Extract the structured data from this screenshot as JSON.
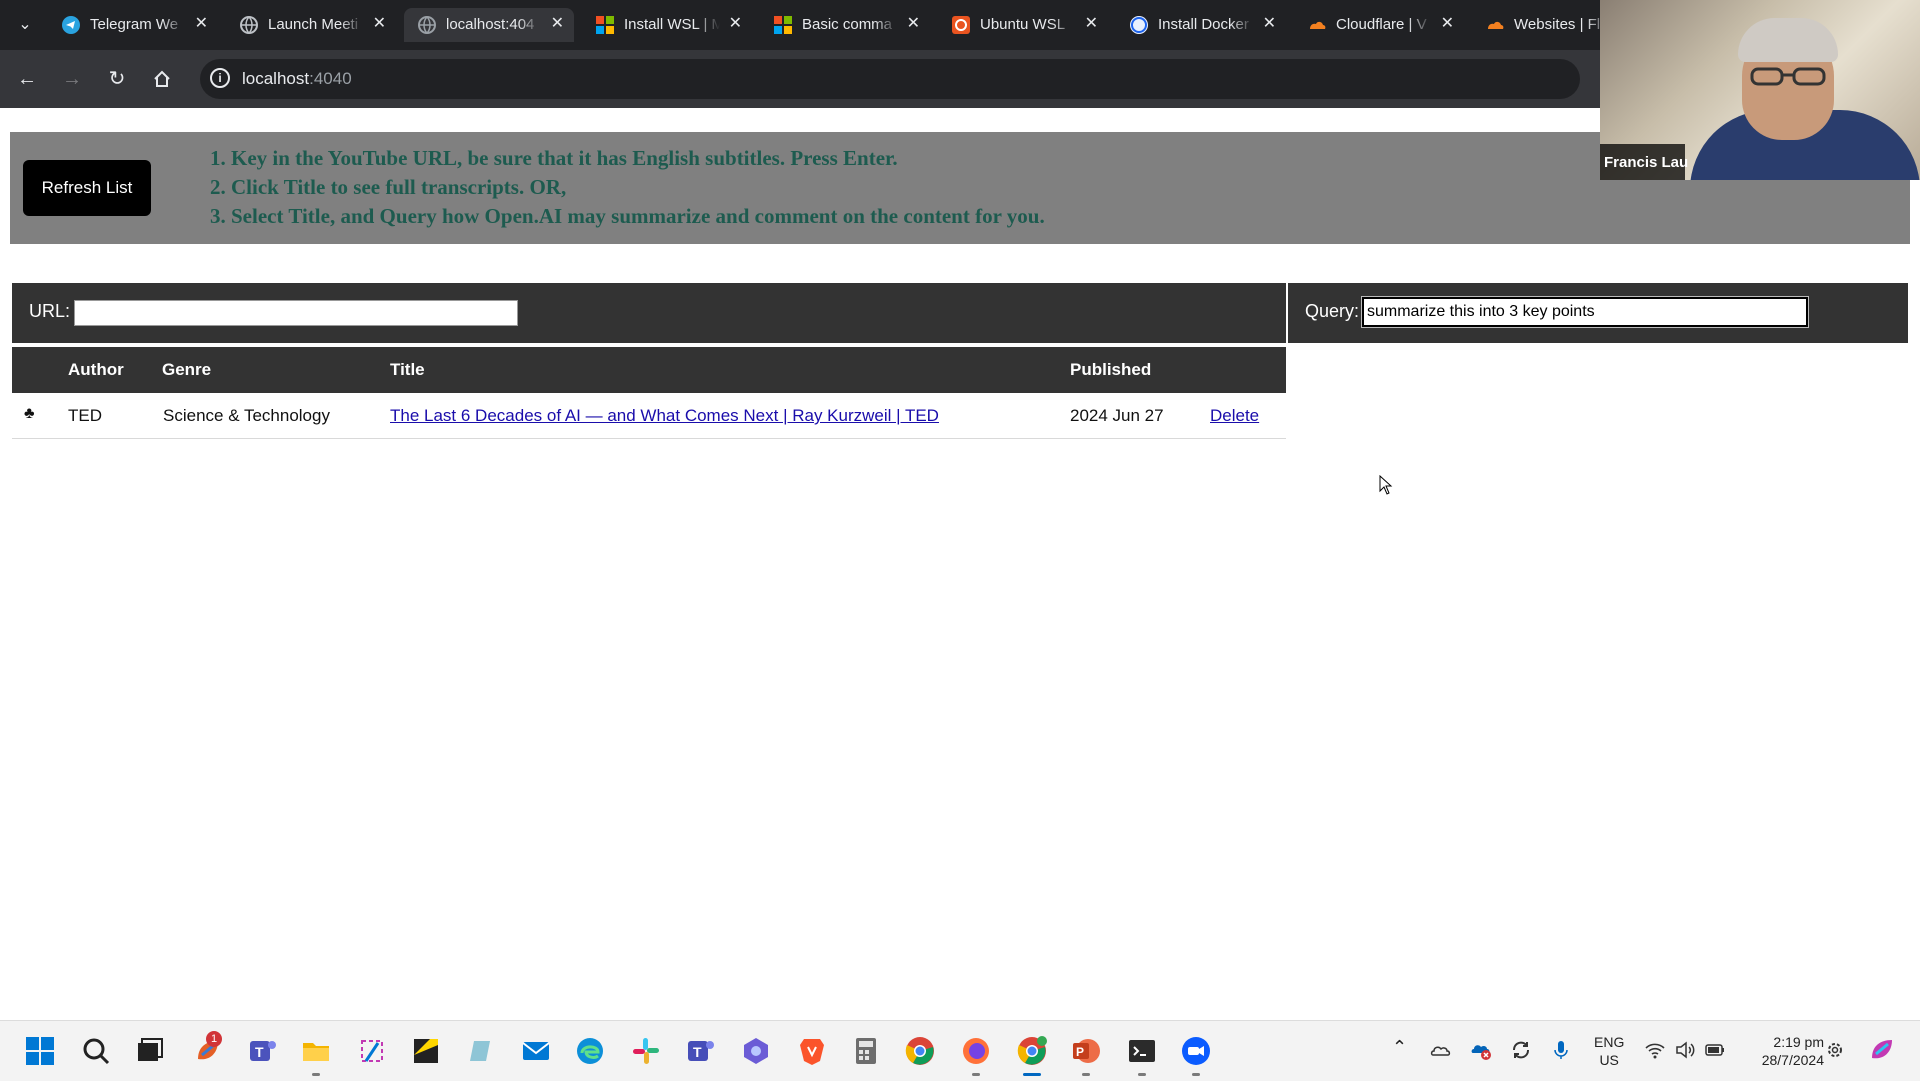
{
  "browser": {
    "tabs": [
      {
        "title": "Telegram We",
        "icon": "telegram-icon",
        "active": false
      },
      {
        "title": "Launch Meeti",
        "icon": "globe-icon",
        "active": false
      },
      {
        "title": "localhost:404",
        "icon": "globe-icon",
        "active": true
      },
      {
        "title": "Install WSL | M",
        "icon": "microsoft-icon",
        "active": false
      },
      {
        "title": "Basic comma",
        "icon": "microsoft-icon",
        "active": false
      },
      {
        "title": "Ubuntu WSL",
        "icon": "ubuntu-icon",
        "active": false
      },
      {
        "title": "Install Docker",
        "icon": "docker-icon",
        "active": false
      },
      {
        "title": "Cloudflare | V",
        "icon": "cloudflare-icon",
        "active": false
      },
      {
        "title": "Websites | Flu",
        "icon": "cloudflare-icon",
        "active": false
      }
    ],
    "address": {
      "host": "localhost",
      "port": ":4040"
    }
  },
  "page": {
    "refresh_label": "Refresh List",
    "instructions": [
      "1. Key in the YouTube URL, be sure that it has English subtitles. Press Enter.",
      "2. Click Title to see full transcripts. OR,",
      "3. Select Title, and Query how Open.AI may summarize and comment on the content for you."
    ],
    "url_label": "URL:",
    "url_value": "",
    "query_label": "Query:",
    "query_value": "summarize this into 3 key points",
    "table": {
      "headers": {
        "author": "Author",
        "genre": "Genre",
        "title": "Title",
        "published": "Published"
      },
      "rows": [
        {
          "icon": "club-icon",
          "icon_glyph": "♣",
          "author": "TED",
          "genre": "Science & Technology",
          "title": "The Last 6 Decades of AI — and What Comes Next | Ray Kurzweil | TED",
          "published": "2024 Jun 27",
          "action": "Delete"
        }
      ]
    }
  },
  "webcam": {
    "name": "Francis Lau"
  },
  "taskbar": {
    "notification_badge": "1",
    "language": {
      "line1": "ENG",
      "line2": "US"
    },
    "clock": {
      "time": "2:19 pm",
      "date": "28/7/2024"
    }
  },
  "colors": {
    "instruction_text": "#1d5b4f",
    "banner_bg": "#808080",
    "bar_bg": "#333333",
    "link": "#1a0dab",
    "chrome_dark": "#202124"
  }
}
